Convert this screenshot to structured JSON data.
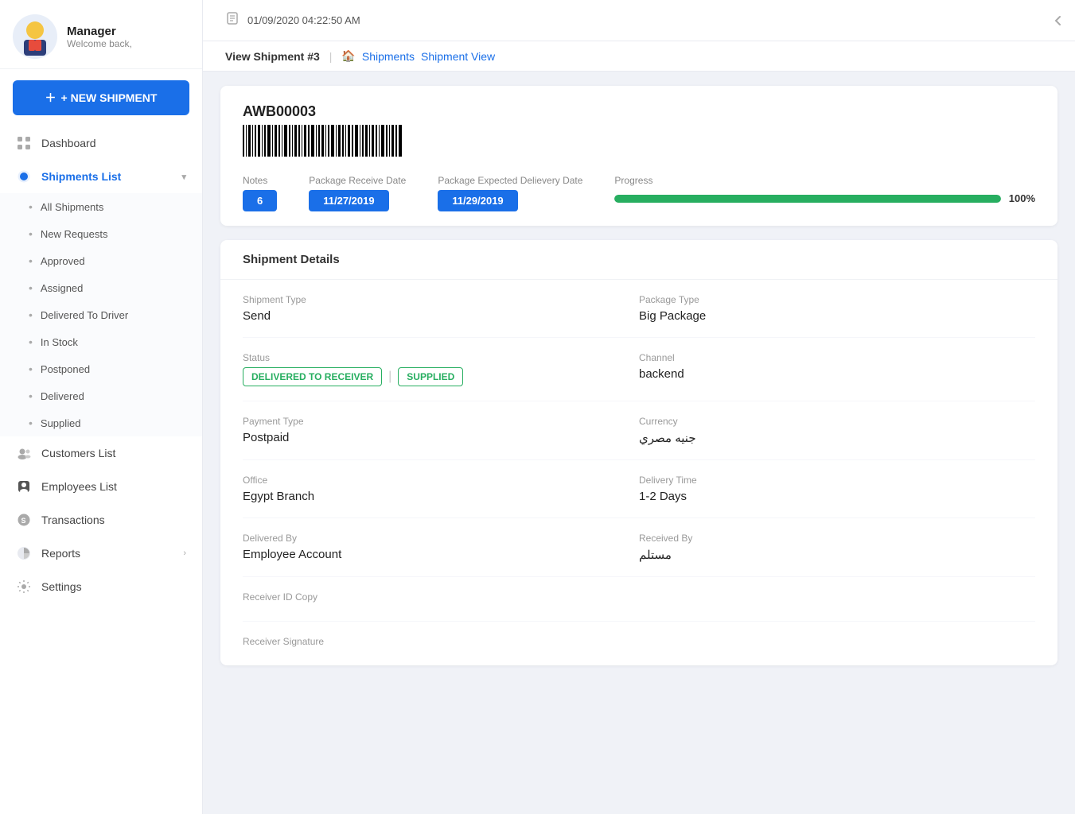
{
  "topbar": {
    "datetime": "01/09/2020 04:22:50 AM"
  },
  "breadcrumb": {
    "page_title": "View Shipment #3",
    "home_link": "Shipments",
    "current": "Shipment View"
  },
  "sidebar": {
    "user": {
      "name": "Manager",
      "welcome": "Welcome back,"
    },
    "new_shipment_label": "+ NEW SHIPMENT",
    "nav": [
      {
        "id": "dashboard",
        "label": "Dashboard",
        "icon": "grid"
      },
      {
        "id": "shipments",
        "label": "Shipments List",
        "icon": "box",
        "active": true,
        "expanded": true
      },
      {
        "id": "customers",
        "label": "Customers List",
        "icon": "users"
      },
      {
        "id": "employees",
        "label": "Employees List",
        "icon": "person"
      },
      {
        "id": "transactions",
        "label": "Transactions",
        "icon": "dollar"
      },
      {
        "id": "reports",
        "label": "Reports",
        "icon": "chart",
        "has_arrow": true
      },
      {
        "id": "settings",
        "label": "Settings",
        "icon": "gear"
      }
    ],
    "shipment_submenu": [
      "All Shipments",
      "New Requests",
      "Approved",
      "Assigned",
      "Delivered To Driver",
      "In Stock",
      "Postponed",
      "Delivered",
      "Supplied"
    ]
  },
  "shipment": {
    "awb": "AWB00003",
    "notes_label": "Notes",
    "notes_value": "6",
    "receive_date_label": "Package Receive Date",
    "receive_date": "11/27/2019",
    "expected_date_label": "Package Expected Delievery Date",
    "expected_date": "11/29/2019",
    "progress_label": "Progress",
    "progress_pct": "100%",
    "progress_value": 100
  },
  "details": {
    "section_title": "Shipment Details",
    "shipment_type_label": "Shipment Type",
    "shipment_type_value": "Send",
    "package_type_label": "Package Type",
    "package_type_value": "Big Package",
    "status_label": "Status",
    "status_delivered": "DELIVERED TO RECEIVER",
    "status_supplied": "SUPPLIED",
    "channel_label": "Channel",
    "channel_value": "backend",
    "payment_type_label": "Payment Type",
    "payment_type_value": "Postpaid",
    "currency_label": "Currency",
    "currency_value": "جنيه مصري",
    "office_label": "Office",
    "office_value": "Egypt Branch",
    "delivery_time_label": "Delivery Time",
    "delivery_time_value": "1-2 Days",
    "delivered_by_label": "Delivered By",
    "delivered_by_value": "Employee Account",
    "received_by_label": "Received By",
    "received_by_value": "مستلم",
    "receiver_id_label": "Receiver ID Copy",
    "receiver_signature_label": "Receiver Signature"
  }
}
